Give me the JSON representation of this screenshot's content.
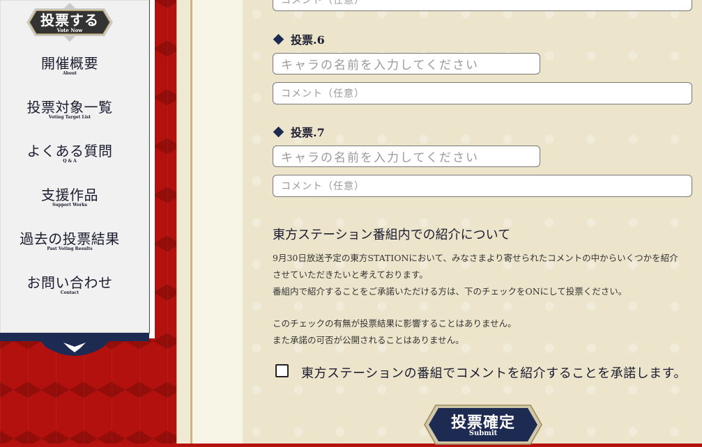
{
  "sidebar": {
    "vote_now": {
      "label": "投票する",
      "sub": "Vote Now"
    },
    "items": [
      {
        "label": "開催概要",
        "sub": "About"
      },
      {
        "label": "投票対象一覧",
        "sub": "Voting Target List"
      },
      {
        "label": "よくある質問",
        "sub": "Q & A"
      },
      {
        "label": "支援作品",
        "sub": "Support Works"
      },
      {
        "label": "過去の投票結果",
        "sub": "Past Voting Results"
      },
      {
        "label": "お問い合わせ",
        "sub": "Contact"
      }
    ]
  },
  "form": {
    "top_comment_placeholder": "コメント（任意）",
    "votes": [
      {
        "heading": "投票.6",
        "name_placeholder": "キャラの名前を入力してください",
        "comment_placeholder": "コメント（任意）"
      },
      {
        "heading": "投票.7",
        "name_placeholder": "キャラの名前を入力してください",
        "comment_placeholder": "コメント（任意）"
      }
    ]
  },
  "notice": {
    "title": "東方ステーション番組内での紹介について",
    "line1": "9月30日放送予定の東方STATIONにおいて、みなさまより寄せられたコメントの中からいくつかを紹介",
    "line2": "させていただきたいと考えております。",
    "line3": "番組内で紹介することをご承諾いただける方は、下のチェックをONにして投票ください。",
    "line4": "このチェックの有無が投票結果に影響することはありません。",
    "line5": "また承諾の可否が公開されることはありません。"
  },
  "consent": {
    "label": "東方ステーションの番組でコメントを紹介することを承諾します。",
    "checked": false
  },
  "submit": {
    "label": "投票確定",
    "sub": "Submit"
  },
  "colors": {
    "navy": "#1d2a52",
    "red": "#b3110e",
    "cream": "#ece5cc"
  }
}
